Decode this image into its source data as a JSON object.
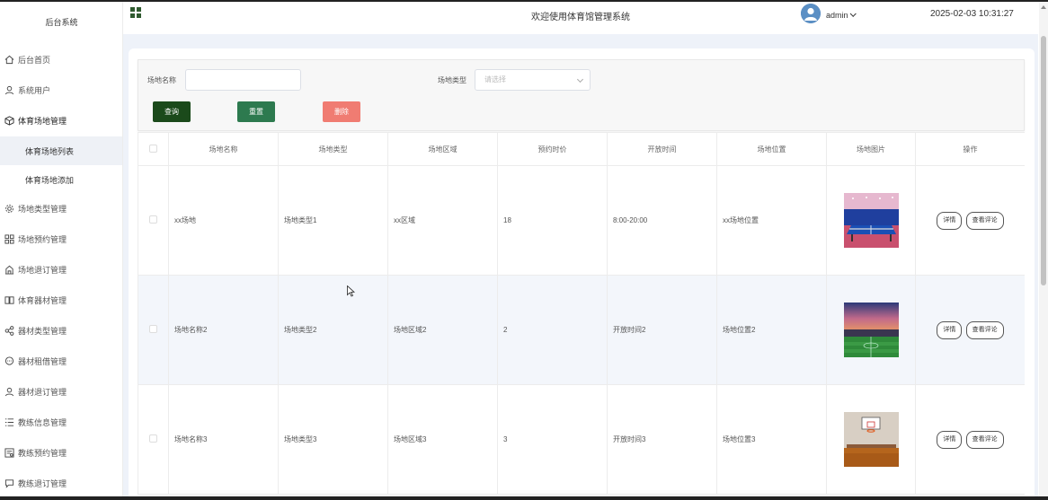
{
  "app": {
    "brand": "后台系统",
    "header_title": "欢迎使用体育馆管理系统",
    "user": "admin",
    "datetime": "2025-02-03 10:31:27"
  },
  "sidebar": {
    "items": [
      {
        "label": "后台首页",
        "icon": "home-icon"
      },
      {
        "label": "系统用户",
        "icon": "user-icon"
      },
      {
        "label": "体育场地管理",
        "icon": "cube-icon",
        "expanded": true
      },
      {
        "label": "体育场地列表",
        "sub": true,
        "active": true
      },
      {
        "label": "体育场地添加",
        "sub": true
      },
      {
        "label": "场地类型管理",
        "icon": "gear-icon"
      },
      {
        "label": "场地预约管理",
        "icon": "grid-icon"
      },
      {
        "label": "场地退订管理",
        "icon": "building-icon"
      },
      {
        "label": "体育器材管理",
        "icon": "book-icon"
      },
      {
        "label": "器材类型管理",
        "icon": "share-icon"
      },
      {
        "label": "器材租借管理",
        "icon": "chat-icon"
      },
      {
        "label": "器材退订管理",
        "icon": "user-icon"
      },
      {
        "label": "教练信息管理",
        "icon": "list-icon"
      },
      {
        "label": "教练预约管理",
        "icon": "form-icon"
      },
      {
        "label": "教练退订管理",
        "icon": "chat-icon"
      }
    ]
  },
  "search": {
    "name_label": "场地名称",
    "name_value": "",
    "type_label": "场地类型",
    "type_placeholder": "请选择",
    "query_button": "查询",
    "reset_button": "重置",
    "delete_button": "删除"
  },
  "colors": {
    "query": "#1b4a1b",
    "reset": "#2d7a4f",
    "delete": "#f07c72"
  },
  "table": {
    "columns": [
      "场地名称",
      "场地类型",
      "场地区域",
      "预约时价",
      "开放时间",
      "场地位置",
      "场地图片",
      "操作"
    ],
    "detail_label": "详情",
    "review_label": "查看评论",
    "rows": [
      {
        "name": "xx场地",
        "type": "场地类型1",
        "area": "xx区域",
        "price": "18",
        "open": "8:00-20:00",
        "location": "xx场地位置",
        "image": "table-tennis-court"
      },
      {
        "name": "场地名称2",
        "type": "场地类型2",
        "area": "场地区域2",
        "price": "2",
        "open": "开放时间2",
        "location": "场地位置2",
        "image": "football-stadium"
      },
      {
        "name": "场地名称3",
        "type": "场地类型3",
        "area": "场地区域3",
        "price": "3",
        "open": "开放时间3",
        "location": "场地位置3",
        "image": "indoor-basketball-court"
      }
    ]
  }
}
